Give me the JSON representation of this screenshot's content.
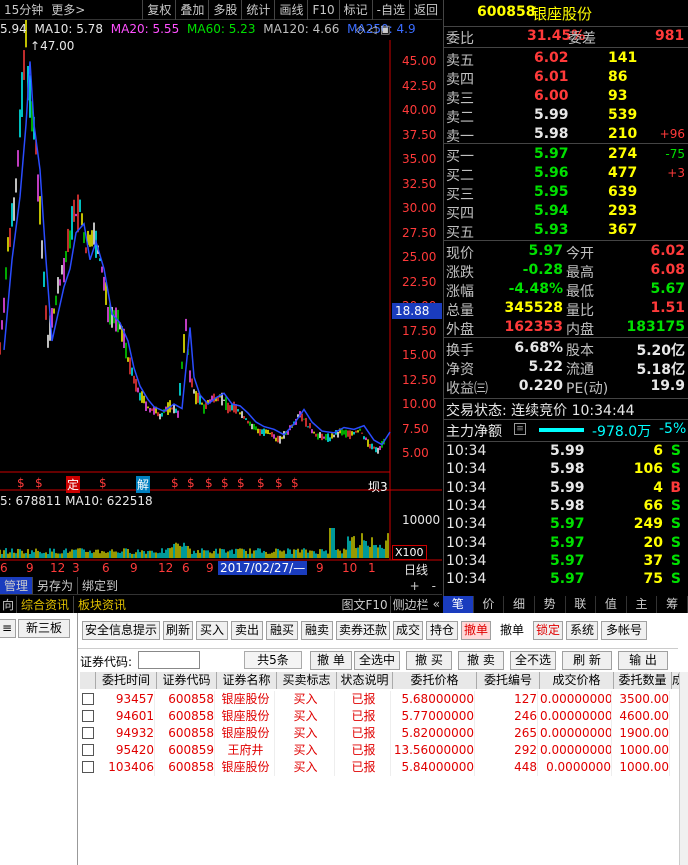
{
  "toolbar": {
    "period": "15分钟",
    "more": "更多>",
    "items": [
      "复权",
      "叠加",
      "多股",
      "统计",
      "画线",
      "F10",
      "标记",
      "-自选",
      "返回"
    ]
  },
  "ma_line": {
    "price": "5.94",
    "ma10": "MA10: 5.78",
    "ma20": "MA20: 5.55",
    "ma60": "MA60: 5.23",
    "ma120": "MA120: 4.66",
    "ma250": "MA250: 4.9"
  },
  "price_axis": [
    "45.00",
    "42.50",
    "40.00",
    "37.50",
    "35.00",
    "32.50",
    "30.00",
    "27.50",
    "25.00",
    "22.50",
    "20.00",
    "17.50",
    "15.00",
    "12.50",
    "10.00",
    "7.50",
    "5.00"
  ],
  "peak_label": "47.00",
  "current_tag": "18.88",
  "low_label": "坝3",
  "markers": [
    "$",
    "$",
    "定",
    "$",
    "解",
    "$",
    "$",
    "$",
    "$",
    "$",
    "$",
    "$",
    "$"
  ],
  "volume": {
    "text": "5: 678811  MA10: 622518",
    "axis": "10000",
    "unit": "X100"
  },
  "date_axis": [
    "6",
    "9",
    "12",
    "3",
    "6",
    "9",
    "12",
    "6",
    "9"
  ],
  "date_highlight": "2017/02/27/—",
  "date_axis_right": [
    "9",
    "10",
    "1"
  ],
  "period_label": "日线",
  "bottom_tabs": [
    "管理",
    "另存为",
    "绑定到"
  ],
  "bottom_tabs2": [
    "向",
    "综合资讯",
    "板块资讯"
  ],
  "right_tools": [
    "图文F10",
    "侧边栏"
  ],
  "right_tabs": [
    "笔",
    "价",
    "细",
    "势",
    "联",
    "值",
    "主",
    "筹"
  ],
  "stock": {
    "code": "600858",
    "name": "银座股份"
  },
  "weibi": {
    "label": "委比",
    "value": "31.45%",
    "label2": "委差",
    "value2": "981"
  },
  "asks": [
    {
      "label": "卖五",
      "price": "6.02",
      "vol": "141",
      "chg": ""
    },
    {
      "label": "卖四",
      "price": "6.01",
      "vol": "86",
      "chg": ""
    },
    {
      "label": "卖三",
      "price": "6.00",
      "vol": "93",
      "chg": ""
    },
    {
      "label": "卖二",
      "price": "5.99",
      "vol": "539",
      "chg": ""
    },
    {
      "label": "卖一",
      "price": "5.98",
      "vol": "210",
      "chg": "+96"
    }
  ],
  "bids": [
    {
      "label": "买一",
      "price": "5.97",
      "vol": "274",
      "chg": "-75"
    },
    {
      "label": "买二",
      "price": "5.96",
      "vol": "477",
      "chg": "+3"
    },
    {
      "label": "买三",
      "price": "5.95",
      "vol": "639",
      "chg": ""
    },
    {
      "label": "买四",
      "price": "5.94",
      "vol": "293",
      "chg": ""
    },
    {
      "label": "买五",
      "price": "5.93",
      "vol": "367",
      "chg": ""
    }
  ],
  "stats": [
    {
      "l1": "现价",
      "v1": "5.97",
      "l2": "今开",
      "v2": "6.02"
    },
    {
      "l1": "涨跌",
      "v1": "-0.28",
      "l2": "最高",
      "v2": "6.08"
    },
    {
      "l1": "涨幅",
      "v1": "-4.48%",
      "l2": "最低",
      "v2": "5.67"
    },
    {
      "l1": "总量",
      "v1": "345528",
      "l2": "量比",
      "v2": "1.51"
    },
    {
      "l1": "外盘",
      "v1": "162353",
      "l2": "内盘",
      "v2": "183175"
    }
  ],
  "stats2": [
    {
      "l1": "换手",
      "v1": "6.68%",
      "l2": "股本",
      "v2": "5.20亿"
    },
    {
      "l1": "净资",
      "v1": "5.22",
      "l2": "流通",
      "v2": "5.18亿"
    },
    {
      "l1": "收益㈢",
      "v1": "0.220",
      "l2": "PE(动)",
      "v2": "19.9"
    }
  ],
  "trade_status": "交易状态: 连续竞价 10:34:44",
  "net_flow": {
    "label": "主力净额",
    "value": "-978.0万",
    "pct": "-5%"
  },
  "ticks": [
    {
      "time": "10:34",
      "price": "5.99",
      "vol": "6",
      "side": "S"
    },
    {
      "time": "10:34",
      "price": "5.98",
      "vol": "106",
      "side": "S"
    },
    {
      "time": "10:34",
      "price": "5.99",
      "vol": "4",
      "side": "B"
    },
    {
      "time": "10:34",
      "price": "5.98",
      "vol": "66",
      "side": "S"
    },
    {
      "time": "10:34",
      "price": "5.97",
      "vol": "249",
      "side": "S"
    },
    {
      "time": "10:34",
      "price": "5.97",
      "vol": "20",
      "side": "S"
    },
    {
      "time": "10:34",
      "price": "5.97",
      "vol": "37",
      "side": "S"
    },
    {
      "time": "10:34",
      "price": "5.97",
      "vol": "75",
      "side": "S"
    }
  ],
  "left_pane": {
    "tab1": "≡",
    "tab2": "新三板"
  },
  "trade_toolbar": [
    "安全信息提示",
    "刷新",
    "买入",
    "卖出",
    "融买",
    "融卖",
    "卖券还款",
    "成交",
    "持仓",
    "撤单",
    "撤单",
    "锁定",
    "系统",
    "多帐号"
  ],
  "search": {
    "label": "证券代码:",
    "value": "",
    "count": "共5条"
  },
  "actions": [
    "撤 单",
    "全选中",
    "撤 买",
    "撤 卖",
    "全不选",
    "刷 新",
    "输 出"
  ],
  "table": {
    "headers": [
      "",
      "委托时间",
      "证券代码",
      "证券名称",
      "买卖标志",
      "状态说明",
      "委托价格",
      "委托编号",
      "成交价格",
      "委托数量",
      "成"
    ],
    "rows": [
      [
        "93457",
        "600858",
        "银座股份",
        "买入",
        "已报",
        "5.68000000",
        "127",
        "0.00000000",
        "3500.00"
      ],
      [
        "94601",
        "600858",
        "银座股份",
        "买入",
        "已报",
        "5.77000000",
        "246",
        "0.00000000",
        "4600.00"
      ],
      [
        "94932",
        "600858",
        "银座股份",
        "买入",
        "已报",
        "5.82000000",
        "265",
        "0.00000000",
        "1900.00"
      ],
      [
        "95420",
        "600859",
        "王府井",
        "买入",
        "已报",
        "13.56000000",
        "292",
        "0.00000000",
        "1000.00"
      ],
      [
        "103406",
        "600858",
        "银座股份",
        "买入",
        "已报",
        "5.84000000",
        "448",
        "0.0000000",
        "1000.00"
      ]
    ]
  },
  "colors": {
    "up": "#ff3a3a",
    "down": "#00e000",
    "accent": "#ffff00",
    "bg": "#000000"
  }
}
